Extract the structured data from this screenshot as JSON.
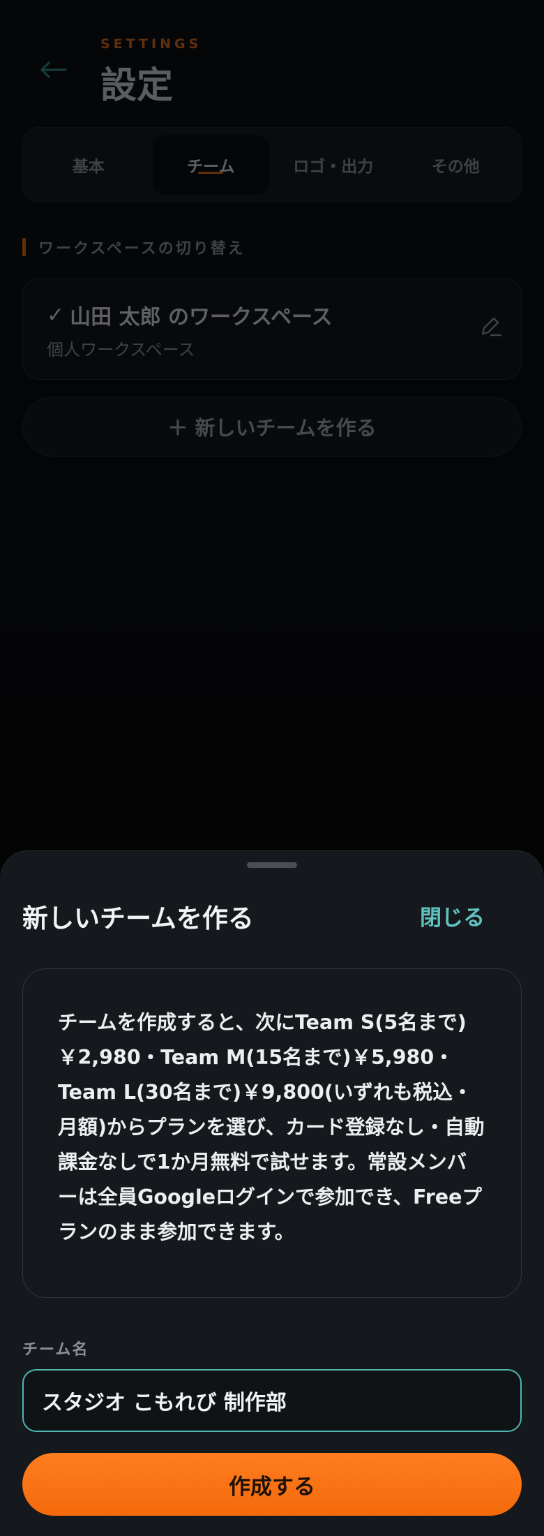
{
  "header": {
    "eyebrow": "SETTINGS",
    "title": "設定"
  },
  "tabs": [
    {
      "label": "基本",
      "active": false
    },
    {
      "label": "チーム",
      "active": true
    },
    {
      "label": "ロゴ・出力",
      "active": false
    },
    {
      "label": "その他",
      "active": false
    }
  ],
  "workspace": {
    "section_label": "ワークスペースの切り替え",
    "current": {
      "check": "✓",
      "name": "山田 太郎 のワークスペース",
      "subtitle": "個人ワークスペース"
    },
    "new_team_label": "＋ 新しいチームを作る"
  },
  "sheet": {
    "title": "新しいチームを作る",
    "close_label": "閉じる",
    "info": "チームを作成すると、次にTeam S(5名まで)￥2,980・Team M(15名まで)￥5,980・Team L(30名まで)￥9,800(いずれも税込・月額)からプランを選び、カード登録なし・自動課金なしで1か月無料で試せます。常設メンバーは全員Googleログインで参加でき、Freeプランのまま参加できます。",
    "field_label": "チーム名",
    "team_name_value": "スタジオ こもれび 制作部",
    "create_label": "作成する"
  },
  "colors": {
    "accent_orange": "#f46a0b",
    "accent_teal": "#5fc4c0"
  }
}
